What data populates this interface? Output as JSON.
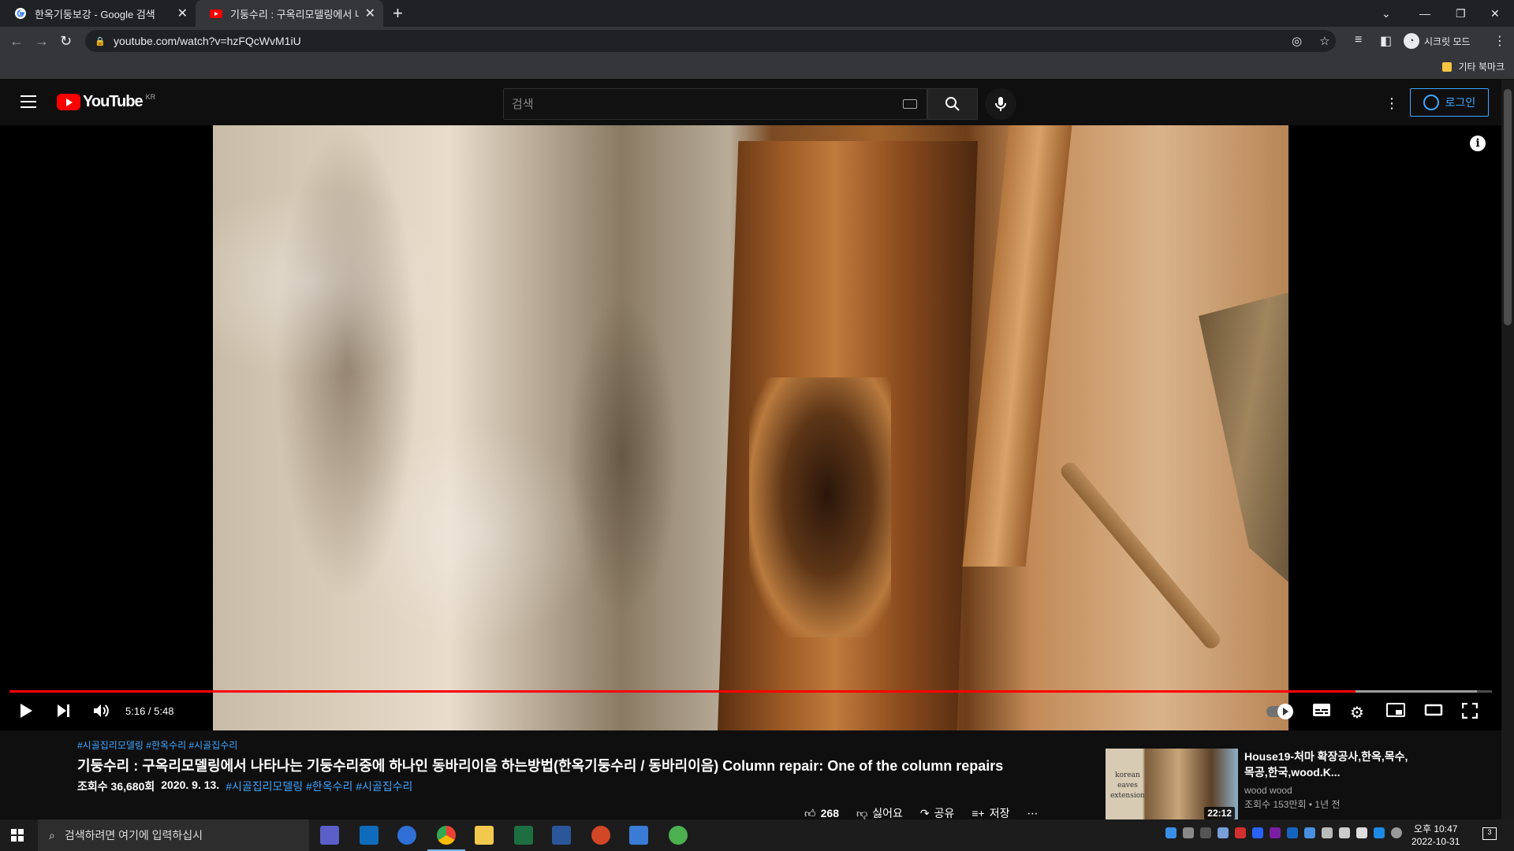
{
  "browser": {
    "tabs": [
      {
        "title": "한옥기둥보강 - Google 검색",
        "active": false
      },
      {
        "title": "기둥수리 : 구옥리모델링에서 나타나는",
        "active": true
      }
    ],
    "url": "youtube.com/watch?v=hzFQcWvM1iU",
    "profile_label": "시크릿 모드",
    "bookmark_folder": "기타 북마크"
  },
  "youtube": {
    "country": "KR",
    "search_placeholder": "검색",
    "signin_label": "로그인"
  },
  "player": {
    "time": "5:16 / 5:48",
    "progress_fraction": 0.908
  },
  "video": {
    "hashtags_top": "#시골집리모델링 #한옥수리 #시골집수리",
    "title": "기둥수리 : 구옥리모델링에서 나타나는 기둥수리중에 하나인 동바리이음 하는방법(한옥기둥수리 / 동바리이음) Column repair: One of the column repairs",
    "views": "조회수 36,680회",
    "date": "2020. 9. 13.",
    "hashtags_bottom": "#시골집리모델링 #한옥수리 #시골집수리",
    "likes": "268",
    "dislike_label": "싫어요",
    "share_label": "공유",
    "save_label": "저장"
  },
  "recommendation": {
    "thumb_text": "korean eaves extension",
    "duration": "22:12",
    "title": "House19-처마 확장공사,한옥,목수,목공,한국,wood.K...",
    "channel": "wood wood",
    "stats": "조회수 153만회 • 1년 전"
  },
  "taskbar": {
    "search_placeholder": "검색하려면 여기에 입력하십시",
    "time": "오후 10:47",
    "date": "2022-10-31",
    "notifications": "3"
  }
}
